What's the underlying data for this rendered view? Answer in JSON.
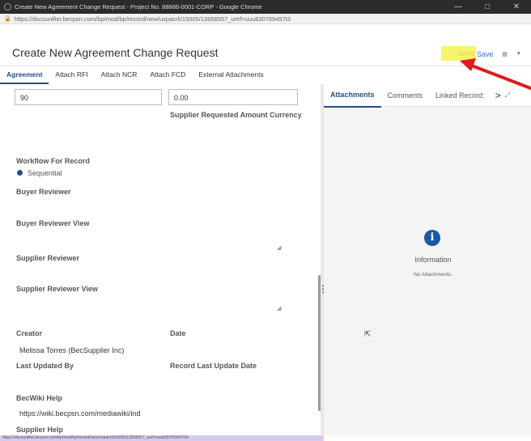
{
  "window": {
    "title": "Create New Agreement Change Request - Project No. 88886-0001-CORP - Google Chrome",
    "minimize": "—",
    "maximize": "□",
    "close": "✕",
    "url": "https://dscsunifier.becpsn.com/bp/mod/bp/record/new/uxpacrli/15005/13658557_uref=uuu830769497t3"
  },
  "header": {
    "title": "Create New Agreement Change Request",
    "send_label": "Send",
    "save_label": "Save",
    "menu_icon": "≡",
    "dropdown_icon": "▾",
    "highlight_color": "#f5f56b",
    "arrow_color": "#e01b1b"
  },
  "tabs": [
    {
      "label": "Agreement",
      "active": true
    },
    {
      "label": "Attach RFI"
    },
    {
      "label": "Attach NCR"
    },
    {
      "label": "Attach FCD"
    },
    {
      "label": "External Attachments"
    }
  ],
  "form": {
    "field1_value": "90",
    "field2_value": "0.00",
    "supplier_currency_label": "Supplier Requested Amount Currency",
    "workflow_label": "Workflow For Record",
    "workflow_option": "Sequential",
    "buyer_reviewer_label": "Buyer Reviewer",
    "buyer_reviewer_view_label": "Buyer Reviewer View",
    "supplier_reviewer_label": "Supplier Reviewer",
    "supplier_reviewer_view_label": "Supplier Reviewer View",
    "creator_label": "Creator",
    "creator_value": "Melissa Torres (BecSupplier Inc)",
    "date_label": "Date",
    "last_updated_by_label": "Last Updated By",
    "record_last_update_label": "Record Last Update Date",
    "becwiki_label": "BecWiki Help",
    "becwiki_value": "https://wiki.becpsn.com/mediawiki/ind",
    "supplier_help_label": "Supplier Help"
  },
  "right_panel": {
    "tabs": [
      {
        "label": "Attachments",
        "active": true
      },
      {
        "label": "Comments"
      },
      {
        "label": "Linked Record:"
      }
    ],
    "next_icon": ">",
    "expand_icon": "⤢",
    "info_icon": "i",
    "info_title": "Information",
    "info_sub": "No Attachments."
  },
  "statusbar": {
    "url": "https://dscsunifier.becpsn.com/bp/mod/bp/record/new/uxpacrli/15005/13658557_uref=uuu830769497t3#"
  }
}
